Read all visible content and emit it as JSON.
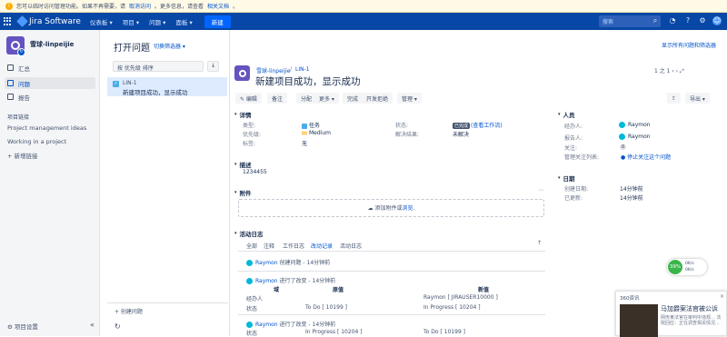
{
  "banner": {
    "text": "您可以临时访问管理功能。如果不再需要，请",
    "link1": "取消访问",
    "text2": "。更多信息，请查看",
    "link2": "相关文档",
    "text3": "。"
  },
  "topnav": {
    "product": "Jira Software",
    "menus": [
      "仪表板 ▾",
      "项目 ▾",
      "问题 ▾",
      "面板 ▾"
    ],
    "create": "新建",
    "search_placeholder": "搜索"
  },
  "sidebar": {
    "project_name": "雪球-linpeijie",
    "items": [
      {
        "label": "汇总",
        "active": false
      },
      {
        "label": "问题",
        "active": true
      },
      {
        "label": "报告",
        "active": false
      }
    ],
    "shortcuts_title": "项目链接",
    "links": [
      "Project management ideas",
      "Working in a project"
    ],
    "add_link": "+ 新增链接",
    "settings": "项目设置",
    "collapse": "«"
  },
  "list": {
    "title": "打开问题",
    "filter_switch": "切换筛选器 ▾",
    "sort_label": "按 优先级 排序",
    "sort_dir": "↓",
    "issues": [
      {
        "key": "LIN-1",
        "summary": "新建项目成功，显示成功"
      }
    ],
    "create_issue": "+ 创建问题",
    "refresh": "↻"
  },
  "detail": {
    "top_link": "显示所有问题和筛选器",
    "breadcrumb_project": "雪球-linpeijie",
    "breadcrumb_sep": "/",
    "breadcrumb_key": "LIN-1",
    "title": "新建项目成功，显示成功",
    "pager": "1 之 1",
    "toolbar": [
      "✎ 编辑",
      "备注",
      "分配",
      "更多 ▾",
      "完成",
      "开发拒绝",
      "管理 ▾"
    ],
    "export": "导出 ▾",
    "details_title": "详情",
    "fields_left": [
      {
        "label": "类型:",
        "value": "任务"
      },
      {
        "label": "优先级:",
        "value": "Medium"
      },
      {
        "label": "标签:",
        "value": "无"
      }
    ],
    "fields_mid": [
      {
        "label": "状态:",
        "status": "已完成",
        "link": "(查看工作流)"
      },
      {
        "label": "解决结果:",
        "value": "未解决"
      }
    ],
    "desc_title": "描述",
    "desc_value": "1234455",
    "attach_title": "附件",
    "attach_drop": "添加附件或",
    "attach_browse": "浏览.",
    "activity_title": "活动日志",
    "activity_tabs": [
      "全部",
      "注释",
      "工作日志",
      "改动记录",
      "活动日志"
    ],
    "activity_sort": "↑",
    "entries": [
      {
        "user": "Raymon",
        "text": "创建问题 - 14分钟前"
      },
      {
        "user": "Raymon",
        "text": "进行了改变 - 14分钟前"
      },
      {
        "user": "Raymon",
        "text": "进行了改变 - 14分钟前"
      }
    ],
    "change_headers": [
      "域",
      "原值",
      "新值"
    ],
    "changes1": [
      {
        "field": "经办人",
        "old": "",
        "new": "Raymon [ JIRAUSER10000 ]"
      },
      {
        "field": "状态",
        "old": "To Do [ 10199 ]",
        "new": "In Progress [ 10204 ]"
      }
    ],
    "changes2": [
      {
        "field": "状态",
        "old": "In Progress [ 10204 ]",
        "new": "To Do [ 10199 ]"
      }
    ],
    "people_title": "人员",
    "people": [
      {
        "label": "经办人:",
        "value": "Raymon"
      },
      {
        "label": "报告人:",
        "value": "Raymon"
      },
      {
        "label": "关注:",
        "value": "0"
      },
      {
        "label": "管理关注列表:",
        "value": "停止关注这个问题"
      }
    ],
    "dates_title": "日期",
    "dates": [
      {
        "label": "创建日期:",
        "value": "14分钟前"
      },
      {
        "label": "已更新:",
        "value": "14分钟前"
      }
    ]
  },
  "widget": {
    "percent": "39%",
    "up": "0K/s",
    "down": "0K/s"
  },
  "popup": {
    "header": "360资讯",
    "title": "马加爵案法官被公诉",
    "body": "网传某法官在审判中违规... 法院回应：正在调查相关情况..."
  }
}
